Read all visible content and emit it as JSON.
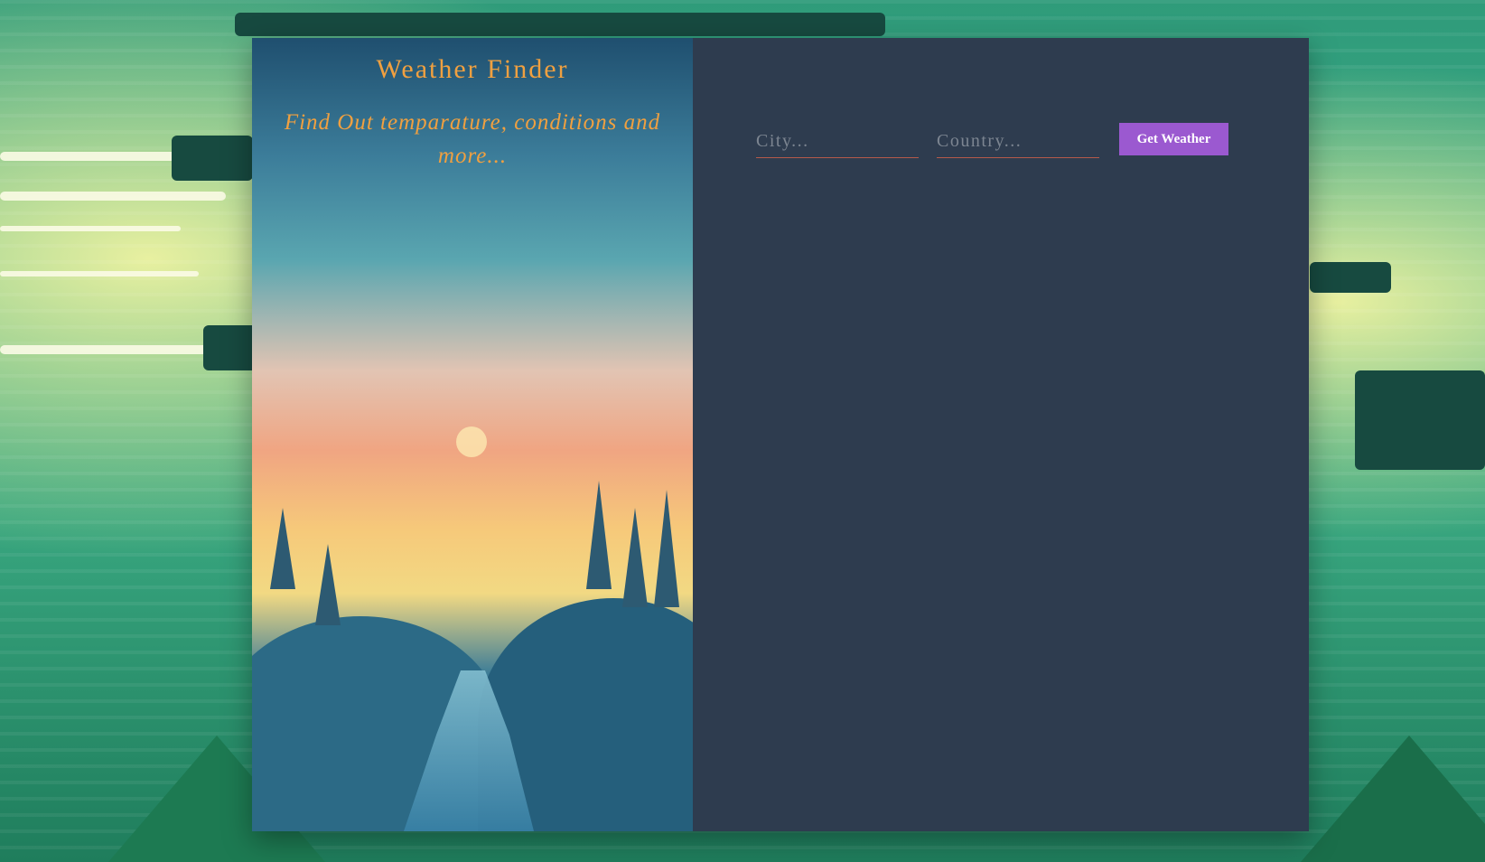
{
  "app": {
    "title": "Weather Finder",
    "subtitle": "Find Out temparature, conditions and more..."
  },
  "form": {
    "city_placeholder": "City...",
    "country_placeholder": "Country...",
    "submit_label": "Get Weather"
  },
  "colors": {
    "title_text": "#f0a040",
    "panel_background": "#2e3c4f",
    "button_background": "#9b59d0",
    "input_underline": "#b55a4a"
  }
}
